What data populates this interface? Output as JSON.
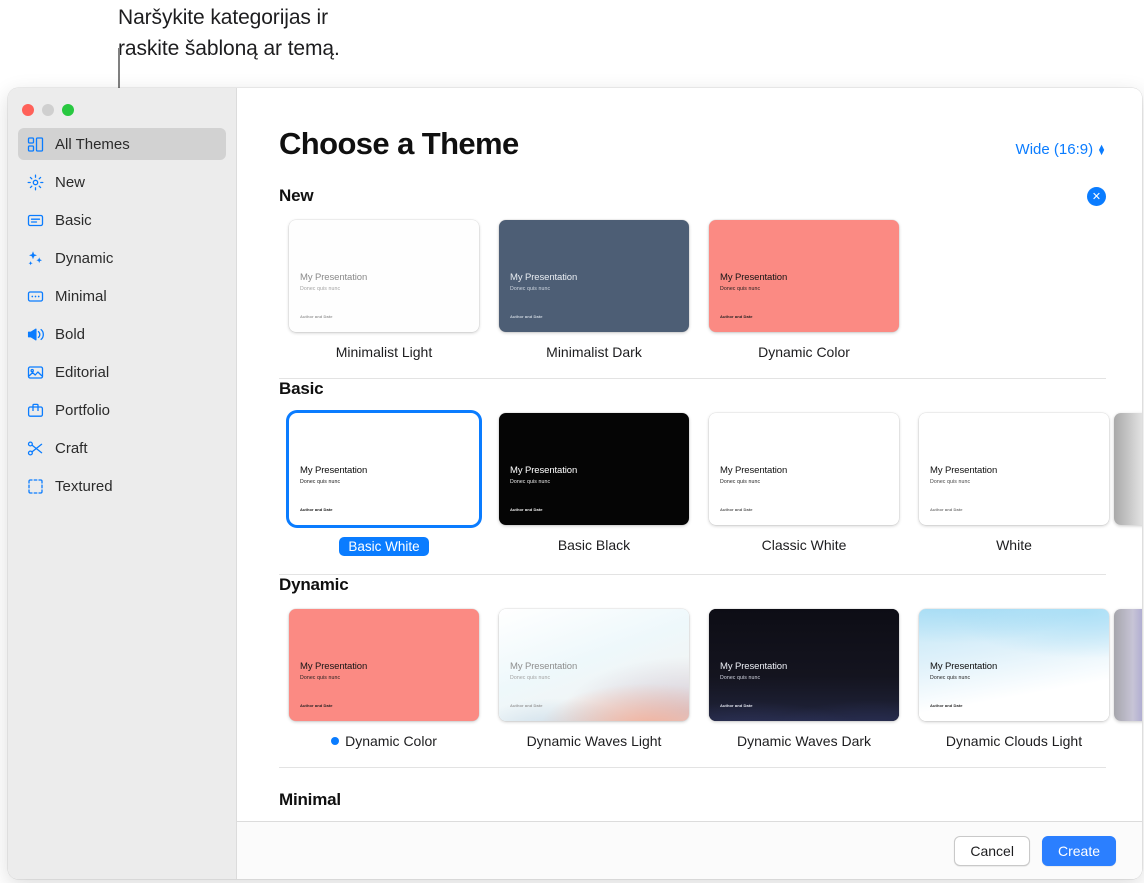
{
  "callout": {
    "text": "Naršykite kategorijas ir\nraskite šabloną ar temą."
  },
  "window": {
    "traffic": {
      "close": "close",
      "minimize": "minimize",
      "zoom": "zoom"
    }
  },
  "sidebar": {
    "items": [
      {
        "label": "All Themes",
        "icon": "grid-icon",
        "selected": true
      },
      {
        "label": "New",
        "icon": "sparkle-burst-icon",
        "selected": false
      },
      {
        "label": "Basic",
        "icon": "rectangle-text-icon",
        "selected": false
      },
      {
        "label": "Dynamic",
        "icon": "sparkles-icon",
        "selected": false
      },
      {
        "label": "Minimal",
        "icon": "ellipsis-rectangle-icon",
        "selected": false
      },
      {
        "label": "Bold",
        "icon": "megaphone-icon",
        "selected": false
      },
      {
        "label": "Editorial",
        "icon": "photo-icon",
        "selected": false
      },
      {
        "label": "Portfolio",
        "icon": "briefcase-icon",
        "selected": false
      },
      {
        "label": "Craft",
        "icon": "scissors-icon",
        "selected": false
      },
      {
        "label": "Textured",
        "icon": "crop-frame-icon",
        "selected": false
      }
    ]
  },
  "header": {
    "title": "Choose a Theme",
    "size_label": "Wide (16:9)"
  },
  "slide_text": {
    "title": "My Presentation",
    "subtitle": "Donec quis nunc",
    "footer": "Author and Date"
  },
  "groups": [
    {
      "title": "New",
      "has_close": true,
      "close_label": "✕",
      "themes": [
        {
          "name": "Minimalist Light",
          "style": "minimalist-light",
          "selected": false,
          "marked": false
        },
        {
          "name": "Minimalist Dark",
          "style": "minimalist-dark",
          "selected": false,
          "marked": false
        },
        {
          "name": "Dynamic Color",
          "style": "dynamic-color",
          "selected": false,
          "marked": false
        }
      ]
    },
    {
      "title": "Basic",
      "has_close": false,
      "themes": [
        {
          "name": "Basic White",
          "style": "basic-white",
          "selected": true,
          "marked": false
        },
        {
          "name": "Basic Black",
          "style": "basic-black",
          "selected": false,
          "marked": false
        },
        {
          "name": "Classic White",
          "style": "classic-white",
          "selected": false,
          "marked": false
        },
        {
          "name": "White",
          "style": "white",
          "selected": false,
          "marked": false
        }
      ],
      "peek": "basic-peek"
    },
    {
      "title": "Dynamic",
      "has_close": false,
      "themes": [
        {
          "name": "Dynamic Color",
          "style": "dynamic-color",
          "selected": false,
          "marked": true
        },
        {
          "name": "Dynamic Waves Light",
          "style": "waves-light",
          "selected": false,
          "marked": false
        },
        {
          "name": "Dynamic Waves Dark",
          "style": "waves-dark",
          "selected": false,
          "marked": false
        },
        {
          "name": "Dynamic Clouds Light",
          "style": "clouds-light",
          "selected": false,
          "marked": false
        }
      ],
      "peek": "dynamic-peek"
    },
    {
      "title": "Minimal",
      "has_close": false,
      "themes": []
    }
  ],
  "footer": {
    "cancel_label": "Cancel",
    "create_label": "Create"
  },
  "colors": {
    "accent": "#0a7cff",
    "primary_button": "#2b7fff",
    "sidebar_bg": "#ececec",
    "selected_row": "#d2d2d2",
    "minimalist_dark": "#4d5e75",
    "dynamic_color": "#fb8a83",
    "basic_black": "#050505",
    "waves_dark": "#12121c"
  }
}
